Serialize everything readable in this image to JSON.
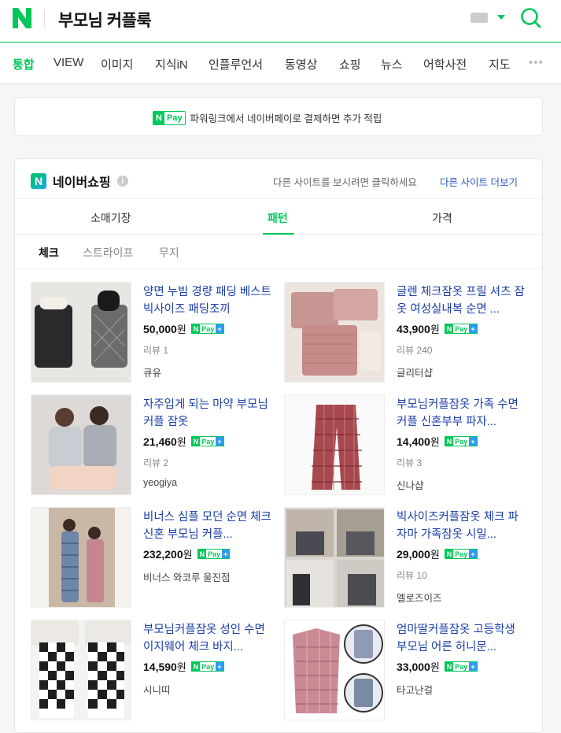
{
  "header": {
    "logo_letter": "N",
    "query": "부모님 커플룩"
  },
  "tabs": [
    {
      "label": "통합",
      "active": true
    },
    {
      "label": "VIEW"
    },
    {
      "label": "이미지"
    },
    {
      "label": "지식iN"
    },
    {
      "label": "인플루언서"
    },
    {
      "label": "동영상"
    },
    {
      "label": "쇼핑"
    },
    {
      "label": "뉴스"
    },
    {
      "label": "어학사전"
    },
    {
      "label": "지도"
    }
  ],
  "more": "•••",
  "pay_banner": {
    "n": "N",
    "pay": "Pay",
    "text": "파워링크에서 네이버페이로 결제하면 추가 적립"
  },
  "shopping": {
    "title": "네이버쇼핑",
    "info": "i",
    "other_message": "다른 사이트를 보시려면 클릭하세요",
    "other_link": "다른 사이트 더보기",
    "sort": [
      {
        "label": "소매기장"
      },
      {
        "label": "패턴",
        "active": true
      },
      {
        "label": "가격"
      }
    ],
    "filters": [
      {
        "label": "체크",
        "active": true
      },
      {
        "label": "스트라이프"
      },
      {
        "label": "무지"
      }
    ],
    "products": [
      {
        "title": "양면 누빔 경량 패딩 베스트 빅사이즈 패딩조끼",
        "price": "50,000",
        "unit": "원",
        "review": "리뷰 1",
        "seller": "큐유"
      },
      {
        "title": "글렌 체크잠옷 프릴 셔츠 잠옷 여성실내복 순면 ...",
        "price": "43,900",
        "unit": "원",
        "review": "리뷰 240",
        "seller": "글리터샵"
      },
      {
        "title": "자주입게 되는 마약 부모님 커플 잠옷",
        "price": "21,460",
        "unit": "원",
        "review": "리뷰 2",
        "seller": "yeogiya"
      },
      {
        "title": "부모님커플잠옷 가족 수면 커플 신혼부부 파자...",
        "price": "14,400",
        "unit": "원",
        "review": "리뷰 3",
        "seller": "신나샵"
      },
      {
        "title": "비너스 심플 모던 순면 체크 신혼 부모님 커플...",
        "price": "232,200",
        "unit": "원",
        "review": "",
        "seller": "비너스 와코루 울진점"
      },
      {
        "title": "빅사이즈커플잠옷 체크 파자마 가족잠옷 시밀...",
        "price": "29,000",
        "unit": "원",
        "review": "리뷰 10",
        "seller": "멜로즈이즈"
      },
      {
        "title": "부모님커플잠옷 성인 수면 이지웨어 체크 바지...",
        "price": "14,590",
        "unit": "원",
        "review": "",
        "seller": "시니띠"
      },
      {
        "title": "엄마딸커플잠옷 고등학생 부모님 어른 허니문...",
        "price": "33,000",
        "unit": "원",
        "review": "",
        "seller": "타고난걸"
      }
    ],
    "npay_n": "N",
    "npay_pay": "Pay",
    "npay_plus": "+"
  },
  "colors": {
    "accent": "#03c75a",
    "link": "#1b3ea8"
  }
}
